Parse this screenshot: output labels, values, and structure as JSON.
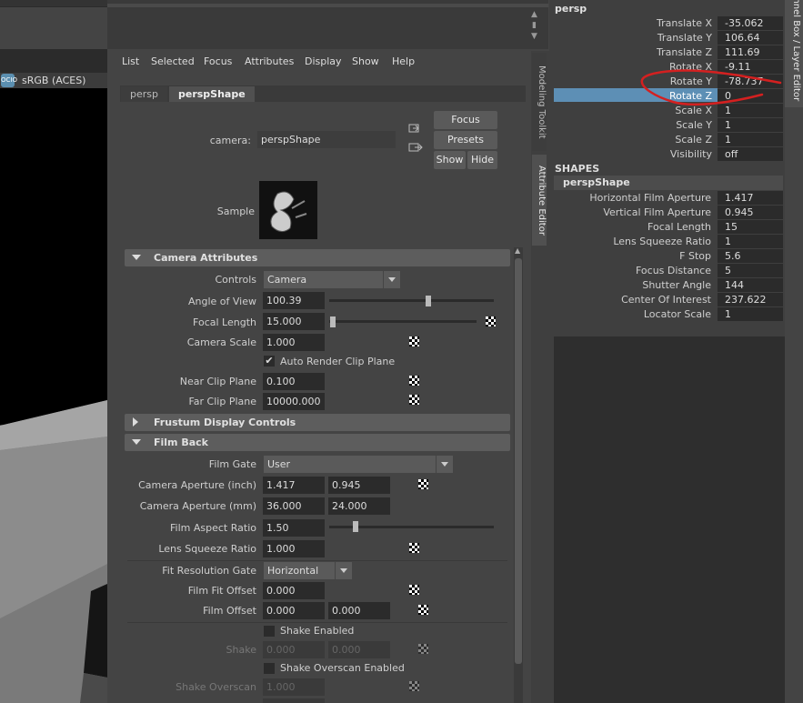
{
  "viewport": {
    "colorspace_icon": "OCIO",
    "colorspace_label": "sRGB (ACES)"
  },
  "menu": [
    "List",
    "Selected",
    "Focus",
    "Attributes",
    "Display",
    "Show",
    "Help"
  ],
  "tabs": {
    "transform": "persp",
    "shape": "perspShape"
  },
  "camera_row": {
    "label": "camera:",
    "value": "perspShape"
  },
  "buttons": {
    "focus": "Focus",
    "presets": "Presets",
    "show": "Show",
    "hide": "Hide"
  },
  "sample_label": "Sample",
  "sections": {
    "camera_attributes": "Camera Attributes",
    "frustum": "Frustum Display Controls",
    "film_back": "Film Back"
  },
  "camera_attributes": {
    "controls": {
      "label": "Controls",
      "value": "Camera"
    },
    "angle_of_view": {
      "label": "Angle of View",
      "value": "100.39",
      "slider": 0.58
    },
    "focal_length": {
      "label": "Focal Length",
      "value": "15.000",
      "slider": 0.0
    },
    "camera_scale": {
      "label": "Camera Scale",
      "value": "1.000"
    },
    "auto_clip": {
      "label": "Auto Render Clip Plane",
      "checked": true
    },
    "near_clip": {
      "label": "Near Clip Plane",
      "value": "0.100"
    },
    "far_clip": {
      "label": "Far Clip Plane",
      "value": "10000.000"
    }
  },
  "film_back": {
    "film_gate": {
      "label": "Film Gate",
      "value": "User"
    },
    "aperture_inch": {
      "label": "Camera Aperture (inch)",
      "v1": "1.417",
      "v2": "0.945"
    },
    "aperture_mm": {
      "label": "Camera Aperture (mm)",
      "v1": "36.000",
      "v2": "24.000"
    },
    "aspect": {
      "label": "Film Aspect Ratio",
      "value": "1.50",
      "slider": 0.16
    },
    "squeeze": {
      "label": "Lens Squeeze Ratio",
      "value": "1.000"
    },
    "fit_gate": {
      "label": "Fit Resolution Gate",
      "value": "Horizontal"
    },
    "fit_offset": {
      "label": "Film Fit Offset",
      "value": "0.000"
    },
    "film_offset": {
      "label": "Film Offset",
      "v1": "0.000",
      "v2": "0.000"
    },
    "shake_enabled": {
      "label": "Shake Enabled",
      "checked": false
    },
    "shake": {
      "label": "Shake",
      "v1": "0.000",
      "v2": "0.000"
    },
    "shake_overscan_enabled": {
      "label": "Shake Overscan Enabled",
      "checked": false
    },
    "shake_overscan": {
      "label": "Shake Overscan",
      "value": "1.000"
    }
  },
  "side_tabs": {
    "modeling": "Modeling Toolkit",
    "attribute": "Attribute Editor",
    "channel": "Channel Box / Layer Editor"
  },
  "channel_box": {
    "object": "persp",
    "attrs": [
      {
        "label": "Translate X",
        "value": "-35.062"
      },
      {
        "label": "Translate Y",
        "value": "106.64"
      },
      {
        "label": "Translate Z",
        "value": "111.69"
      },
      {
        "label": "Rotate X",
        "value": "-9.11"
      },
      {
        "label": "Rotate Y",
        "value": "-78.737"
      },
      {
        "label": "Rotate Z",
        "value": "0"
      },
      {
        "label": "Scale X",
        "value": "1"
      },
      {
        "label": "Scale Y",
        "value": "1"
      },
      {
        "label": "Scale Z",
        "value": "1"
      },
      {
        "label": "Visibility",
        "value": "off"
      }
    ],
    "shapes_header": "SHAPES",
    "shape_name": "perspShape",
    "shape_attrs": [
      {
        "label": "Horizontal Film Aperture",
        "value": "1.417"
      },
      {
        "label": "Vertical Film Aperture",
        "value": "0.945"
      },
      {
        "label": "Focal Length",
        "value": "15"
      },
      {
        "label": "Lens Squeeze Ratio",
        "value": "1"
      },
      {
        "label": "F Stop",
        "value": "5.6"
      },
      {
        "label": "Focus Distance",
        "value": "5"
      },
      {
        "label": "Shutter Angle",
        "value": "144"
      },
      {
        "label": "Center Of Interest",
        "value": "237.622"
      },
      {
        "label": "Locator Scale",
        "value": "1"
      }
    ]
  },
  "colors": {
    "selected": "#5d8fb5",
    "annotation": "#d42020",
    "panel": "#444444"
  }
}
